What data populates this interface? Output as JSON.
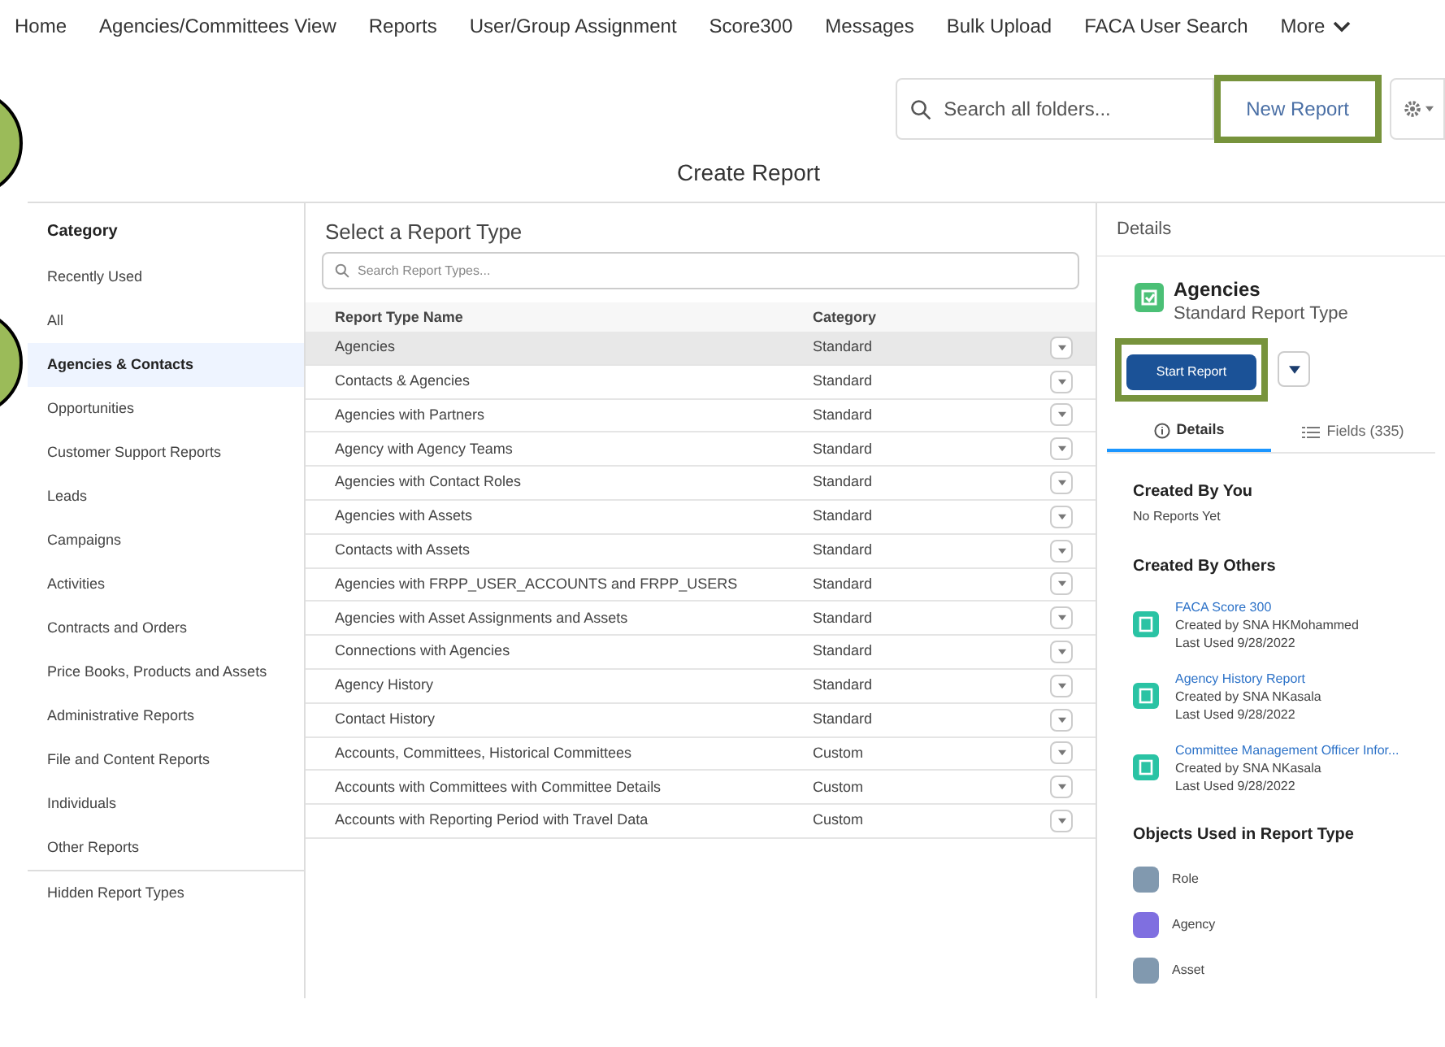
{
  "nav": {
    "items": [
      "Home",
      "Agencies/Committees View",
      "Reports",
      "User/Group Assignment",
      "Score300",
      "Messages",
      "Bulk Upload",
      "FACA User Search"
    ],
    "more": "More"
  },
  "toolbar": {
    "search_placeholder": "Search all folders...",
    "new_report": {
      "label": "New Report",
      "highlighted": true
    }
  },
  "title": "Create Report",
  "sidebar": {
    "heading": "Category",
    "items": [
      {
        "label": "Recently Used",
        "selected": false
      },
      {
        "label": "All",
        "selected": false
      },
      {
        "label": "Agencies & Contacts",
        "selected": true
      },
      {
        "label": "Opportunities",
        "selected": false
      },
      {
        "label": "Customer Support Reports",
        "selected": false
      },
      {
        "label": "Leads",
        "selected": false
      },
      {
        "label": "Campaigns",
        "selected": false
      },
      {
        "label": "Activities",
        "selected": false
      },
      {
        "label": "Contracts and Orders",
        "selected": false
      },
      {
        "label": "Price Books, Products and Assets",
        "selected": false
      },
      {
        "label": "Administrative Reports",
        "selected": false
      },
      {
        "label": "File and Content Reports",
        "selected": false
      },
      {
        "label": "Individuals",
        "selected": false
      },
      {
        "label": "Other Reports",
        "selected": false
      }
    ],
    "footer": "Hidden Report Types"
  },
  "report_types": {
    "heading": "Select a Report Type",
    "search_placeholder": "Search Report Types...",
    "columns": [
      "Report Type Name",
      "Category"
    ],
    "rows": [
      {
        "name": "Agencies",
        "category": "Standard",
        "selected": true
      },
      {
        "name": "Contacts & Agencies",
        "category": "Standard",
        "selected": false
      },
      {
        "name": "Agencies with Partners",
        "category": "Standard",
        "selected": false
      },
      {
        "name": "Agency with Agency Teams",
        "category": "Standard",
        "selected": false
      },
      {
        "name": "Agencies with Contact Roles",
        "category": "Standard",
        "selected": false
      },
      {
        "name": "Agencies with Assets",
        "category": "Standard",
        "selected": false
      },
      {
        "name": "Contacts with Assets",
        "category": "Standard",
        "selected": false
      },
      {
        "name": "Agencies with FRPP_USER_ACCOUNTS and FRPP_USERS",
        "category": "Standard",
        "selected": false
      },
      {
        "name": "Agencies with Asset Assignments and Assets",
        "category": "Standard",
        "selected": false
      },
      {
        "name": "Connections with Agencies",
        "category": "Standard",
        "selected": false
      },
      {
        "name": "Agency History",
        "category": "Standard",
        "selected": false
      },
      {
        "name": "Contact History",
        "category": "Standard",
        "selected": false
      },
      {
        "name": "Accounts, Committees, Historical Committees",
        "category": "Custom",
        "selected": false
      },
      {
        "name": "Accounts with Committees with Committee Details",
        "category": "Custom",
        "selected": false
      },
      {
        "name": "Accounts with Reporting Period with Travel Data",
        "category": "Custom",
        "selected": false
      }
    ]
  },
  "details": {
    "heading": "Details",
    "name": "Agencies",
    "subtitle": "Standard Report Type",
    "start_report": {
      "label": "Start Report",
      "highlighted": true
    },
    "tabs": [
      {
        "label": "Details",
        "selected": true
      },
      {
        "label": "Fields (335)",
        "selected": false
      }
    ],
    "created_by_you": {
      "heading": "Created By You",
      "text": "No Reports Yet"
    },
    "created_by_others": {
      "heading": "Created By Others",
      "reports": [
        {
          "title": "FACA Score 300",
          "creator": "Created by SNA HKMohammed",
          "last_used": "Last Used 9/28/2022"
        },
        {
          "title": "Agency History Report",
          "creator": "Created by SNA NKasala",
          "last_used": "Last Used 9/28/2022"
        },
        {
          "title": "Committee Management Officer Infor...",
          "creator": "Created by SNA NKasala",
          "last_used": "Last Used 9/28/2022"
        }
      ]
    },
    "objects": {
      "heading": "Objects Used in Report Type",
      "items": [
        {
          "label": "Role",
          "color": "#8199af"
        },
        {
          "label": "Agency",
          "color": "#7f6fe0"
        },
        {
          "label": "Asset",
          "color": "#8199af"
        }
      ]
    }
  }
}
